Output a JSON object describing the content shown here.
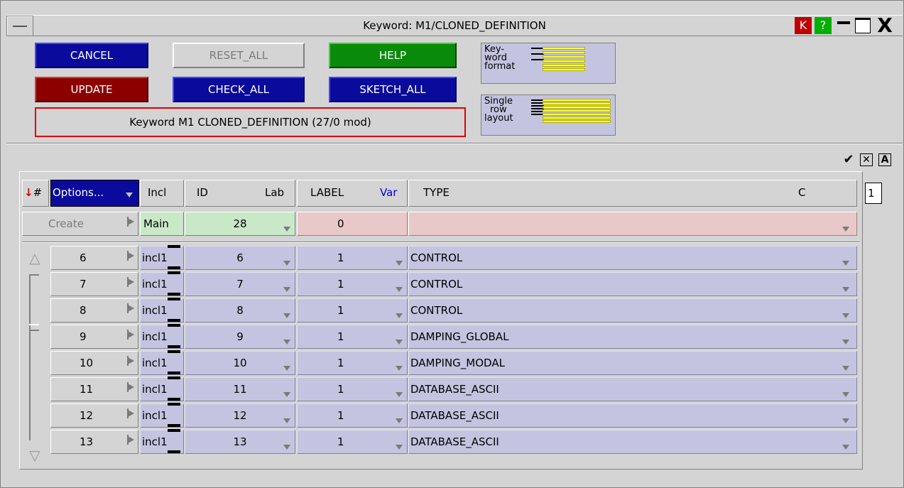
{
  "window": {
    "title": "Keyword: M1/CLONED_DEFINITION",
    "k_label": "K",
    "help_label": "?",
    "close_label": "X"
  },
  "buttons": {
    "cancel": "CANCEL",
    "reset_all": "RESET_ALL",
    "help": "HELP",
    "update": "UPDATE",
    "check_all": "CHECK_ALL",
    "sketch_all": "SKETCH_ALL"
  },
  "status": "Keyword M1  CLONED_DEFINITION (27/0 mod)",
  "format_panels": {
    "keyword_format": [
      "Key-",
      "word",
      "format"
    ],
    "single_row": [
      "Single",
      "row",
      "layout"
    ]
  },
  "toolbar_icons": [
    "checkmark-icon",
    "cross-icon",
    "text-icon"
  ],
  "headers": {
    "hash": "#",
    "options": "Options...",
    "incl": "Incl",
    "id": "ID",
    "lab": "Lab",
    "label": "LABEL",
    "var": "Var",
    "type": "TYPE",
    "c": "C"
  },
  "spinner_value": "1",
  "create_row": {
    "label": "Create",
    "incl": "Main",
    "id": "28",
    "label_val": "0",
    "type": ""
  },
  "rows": [
    {
      "num": "6",
      "incl": "incl1",
      "id": "6",
      "label": "1",
      "type": "CONTROL"
    },
    {
      "num": "7",
      "incl": "incl1",
      "id": "7",
      "label": "1",
      "type": "CONTROL"
    },
    {
      "num": "8",
      "incl": "incl1",
      "id": "8",
      "label": "1",
      "type": "CONTROL"
    },
    {
      "num": "9",
      "incl": "incl1",
      "id": "9",
      "label": "1",
      "type": "DAMPING_GLOBAL"
    },
    {
      "num": "10",
      "incl": "incl1",
      "id": "10",
      "label": "1",
      "type": "DAMPING_MODAL"
    },
    {
      "num": "11",
      "incl": "incl1",
      "id": "11",
      "label": "1",
      "type": "DATABASE_ASCII"
    },
    {
      "num": "12",
      "incl": "incl1",
      "id": "12",
      "label": "1",
      "type": "DATABASE_ASCII"
    },
    {
      "num": "13",
      "incl": "incl1",
      "id": "13",
      "label": "1",
      "type": "DATABASE_ASCII"
    }
  ],
  "colors": {
    "button_blue": "#0a0a9c",
    "button_red": "#8c0000",
    "button_green": "#0a8a0a",
    "row_lavender": "#c4c4e0",
    "create_green": "#c8e8c8",
    "create_pink": "#e8c8c8"
  }
}
